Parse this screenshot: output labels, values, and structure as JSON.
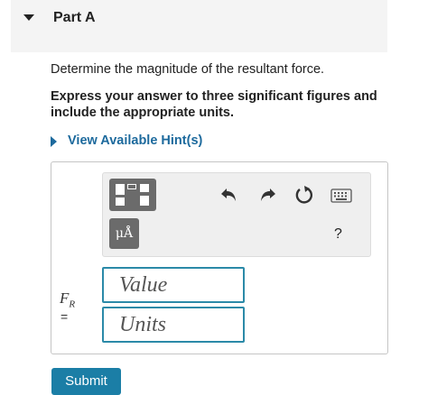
{
  "part": {
    "title": "Part A",
    "collapse_icon": "caret-down-icon"
  },
  "question": {
    "text": "Determine the magnitude of the resultant force.",
    "instruction": "Express your answer to three significant figures and include the appropriate units."
  },
  "hint": {
    "label": "View Available Hint(s)",
    "icon": "caret-right-icon"
  },
  "toolbar": {
    "units_label": "μÅ",
    "help_label": "?",
    "icons": [
      "templates-icon",
      "units-icon",
      "undo-icon",
      "redo-icon",
      "reset-icon",
      "keyboard-icon",
      "help-icon"
    ]
  },
  "answer": {
    "variable": "F",
    "variable_sub": "R",
    "equals": "=",
    "value_placeholder": "Value",
    "units_placeholder": "Units"
  },
  "submit": {
    "label": "Submit"
  },
  "colors": {
    "link": "#1d6a9d",
    "field_border": "#2b8aa8",
    "button": "#1b7ea6",
    "tool_button": "#6b6b6b"
  }
}
